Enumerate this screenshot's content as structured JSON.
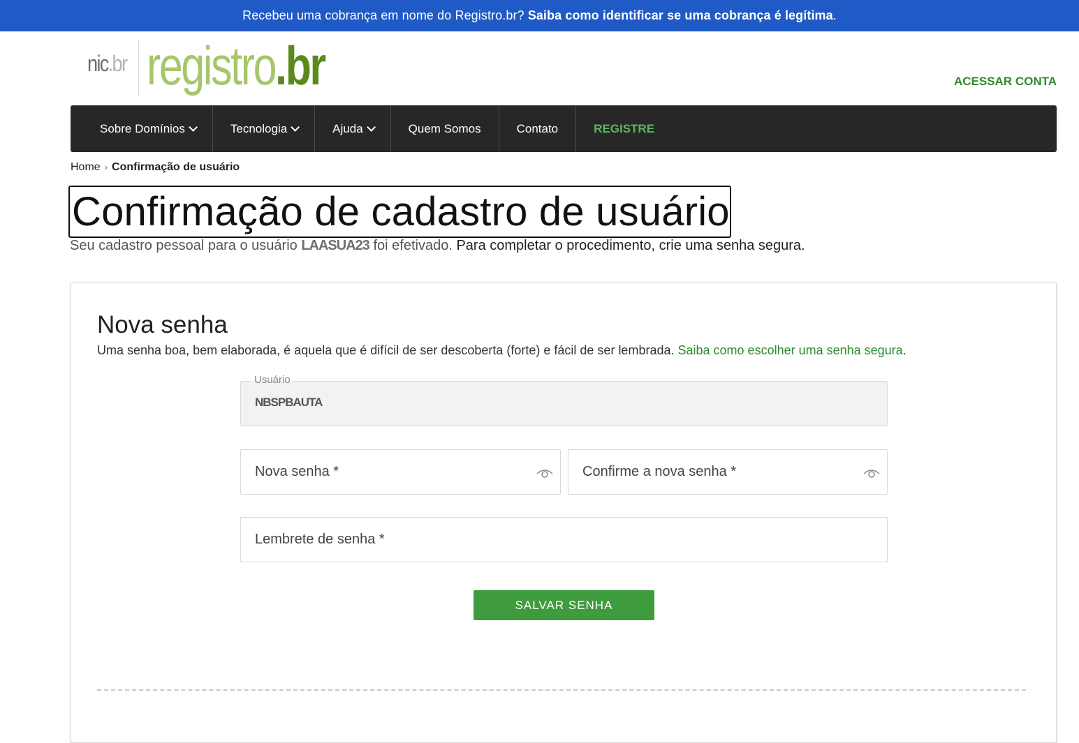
{
  "alert": {
    "text": "Recebeu uma cobrança em nome do Registro.br?",
    "link": "Saiba como identificar se uma cobrança é legítima",
    "end": "."
  },
  "logo": {
    "nic": "nic",
    "nic_br": ".br",
    "registro": "registro",
    "registro_br": ".br"
  },
  "header": {
    "access_account": "ACESSAR CONTA"
  },
  "nav": {
    "items": [
      {
        "label": "Sobre Domínios",
        "dropdown": true
      },
      {
        "label": "Tecnologia",
        "dropdown": true
      },
      {
        "label": "Ajuda",
        "dropdown": true
      },
      {
        "label": "Quem Somos",
        "dropdown": false
      },
      {
        "label": "Contato",
        "dropdown": false
      },
      {
        "label": "REGISTRE",
        "dropdown": false
      }
    ]
  },
  "breadcrumb": {
    "home": "Home",
    "separator": "›",
    "current": "Confirmação de usuário"
  },
  "page": {
    "title": "Confirmação de cadastro de usuário",
    "subtitle_start": "Seu cadastro pessoal para o usuário",
    "subtitle_user": "LAASUA23",
    "subtitle_mid": "foi efetivado.",
    "subtitle_strong": "Para completar o procedimento, crie uma senha segura."
  },
  "card": {
    "title": "Nova senha",
    "desc": "Uma senha boa, bem elaborada, é aquela que é difícil de ser descoberta (forte) e fácil de ser lembrada.",
    "desc_link": "Saiba como escolher uma senha segura",
    "desc_end": "."
  },
  "form": {
    "user_label": "Usuário",
    "user_value": "NBSPBAUTA",
    "new_password_placeholder": "Nova senha *",
    "confirm_password_placeholder": "Confirme a nova senha *",
    "hint_placeholder": "Lembrete de senha *",
    "save_label": "SALVAR SENHA"
  },
  "colors": {
    "alert_bg": "#1f5ac6",
    "brand_green": "#2e8b2e",
    "button_green": "#3e9b3e",
    "nav_bg": "#272727"
  },
  "icons": [
    "eye-icon",
    "chevron-down-icon"
  ]
}
